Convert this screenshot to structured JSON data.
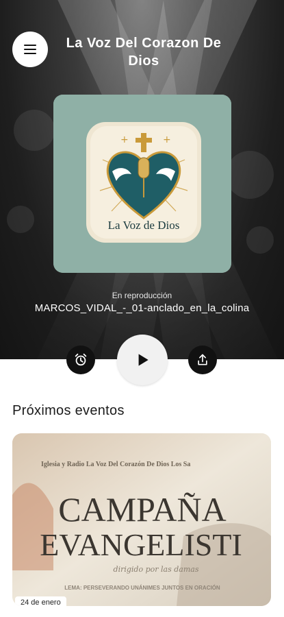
{
  "header": {
    "title": "La Voz Del Corazon De Dios",
    "menu_icon": "menu-icon"
  },
  "artwork": {
    "logo_text": "La Voz de Dios",
    "colors": {
      "background": "#8fb0a6",
      "heart": "#1f5e66",
      "gold": "#c99a3a"
    }
  },
  "player": {
    "status_label": "En reproducción",
    "track_title": "MARCOS_VIDAL_-_01-anclado_en_la_colina",
    "alarm_icon": "alarm-clock-icon",
    "play_icon": "play-icon",
    "share_icon": "share-icon"
  },
  "events": {
    "section_title": "Próximos eventos",
    "items": [
      {
        "banner_top": "Iglesia y Radio La Voz Del Corazón De Dios Los Sa",
        "banner_line1": "CAMPAÑA",
        "banner_line2": "EVANGELISTI",
        "banner_script": "dirigido por las damas",
        "banner_bottom": "LEMA: PERSEVERANDO UNÁNIMES JUNTOS EN ORACIÓN",
        "date": "24 de enero"
      }
    ]
  }
}
